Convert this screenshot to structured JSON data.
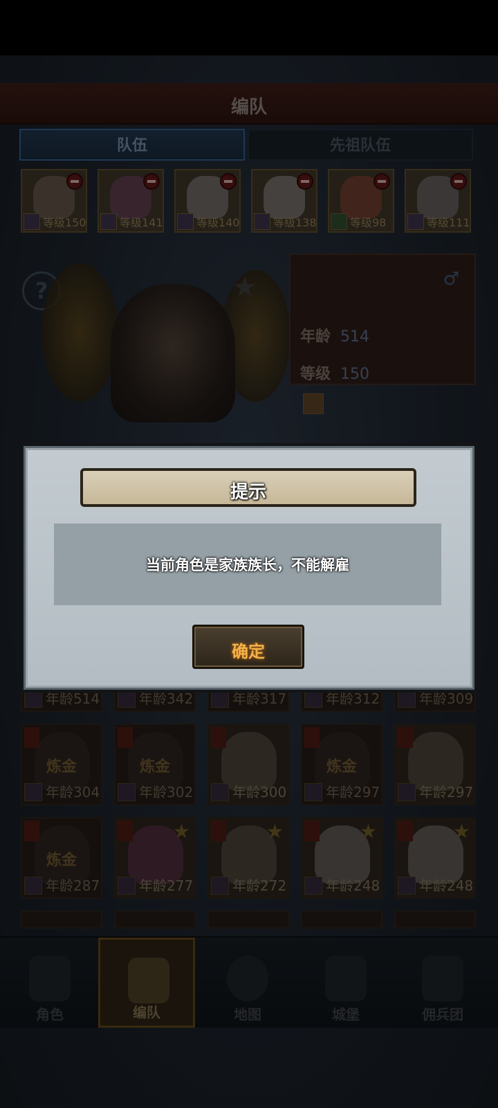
{
  "header": {
    "title": "编队"
  },
  "tabs": [
    {
      "label": "队伍",
      "active": true
    },
    {
      "label": "先祖队伍",
      "active": false
    }
  ],
  "team": [
    {
      "level": "等级150"
    },
    {
      "level": "等级141"
    },
    {
      "level": "等级140"
    },
    {
      "level": "等级138"
    },
    {
      "level": "等级98"
    },
    {
      "level": "等级111"
    }
  ],
  "hero_info": {
    "age_label": "年龄",
    "age_value": "514",
    "level_label": "等级",
    "level_value": "150",
    "gender_symbol": "♂"
  },
  "grid_row0": [
    {
      "age": "年龄514"
    },
    {
      "age": "年龄342"
    },
    {
      "age": "年龄317"
    },
    {
      "age": "年龄312"
    },
    {
      "age": "年龄309"
    }
  ],
  "grid_row1": [
    {
      "tag": "炼金",
      "age": "年龄304"
    },
    {
      "tag": "炼金",
      "age": "年龄302"
    },
    {
      "tag": "",
      "age": "年龄300"
    },
    {
      "tag": "炼金",
      "age": "年龄297"
    },
    {
      "tag": "",
      "age": "年龄297"
    }
  ],
  "grid_row2": [
    {
      "tag": "炼金",
      "age": "年龄287"
    },
    {
      "tag": "",
      "age": "年龄277"
    },
    {
      "tag": "",
      "age": "年龄272"
    },
    {
      "tag": "",
      "age": "年龄248"
    },
    {
      "tag": "",
      "age": "年龄248"
    }
  ],
  "nav": [
    {
      "label": "角色",
      "icon": "knight-icon",
      "active": false
    },
    {
      "label": "编队",
      "icon": "team-helmet-icon",
      "active": true
    },
    {
      "label": "地图",
      "icon": "compass-map-icon",
      "active": false
    },
    {
      "label": "城堡",
      "icon": "castle-icon",
      "active": false
    },
    {
      "label": "佣兵团",
      "icon": "mercenary-ship-icon",
      "active": false
    }
  ],
  "dialog": {
    "title": "提示",
    "message": "当前角色是家族族长，不能解雇",
    "confirm_label": "确定"
  },
  "colors": {
    "dialog_bg": "#bcc5ca",
    "confirm_text": "#f2b24a",
    "active_nav_border": "#5c4418"
  }
}
